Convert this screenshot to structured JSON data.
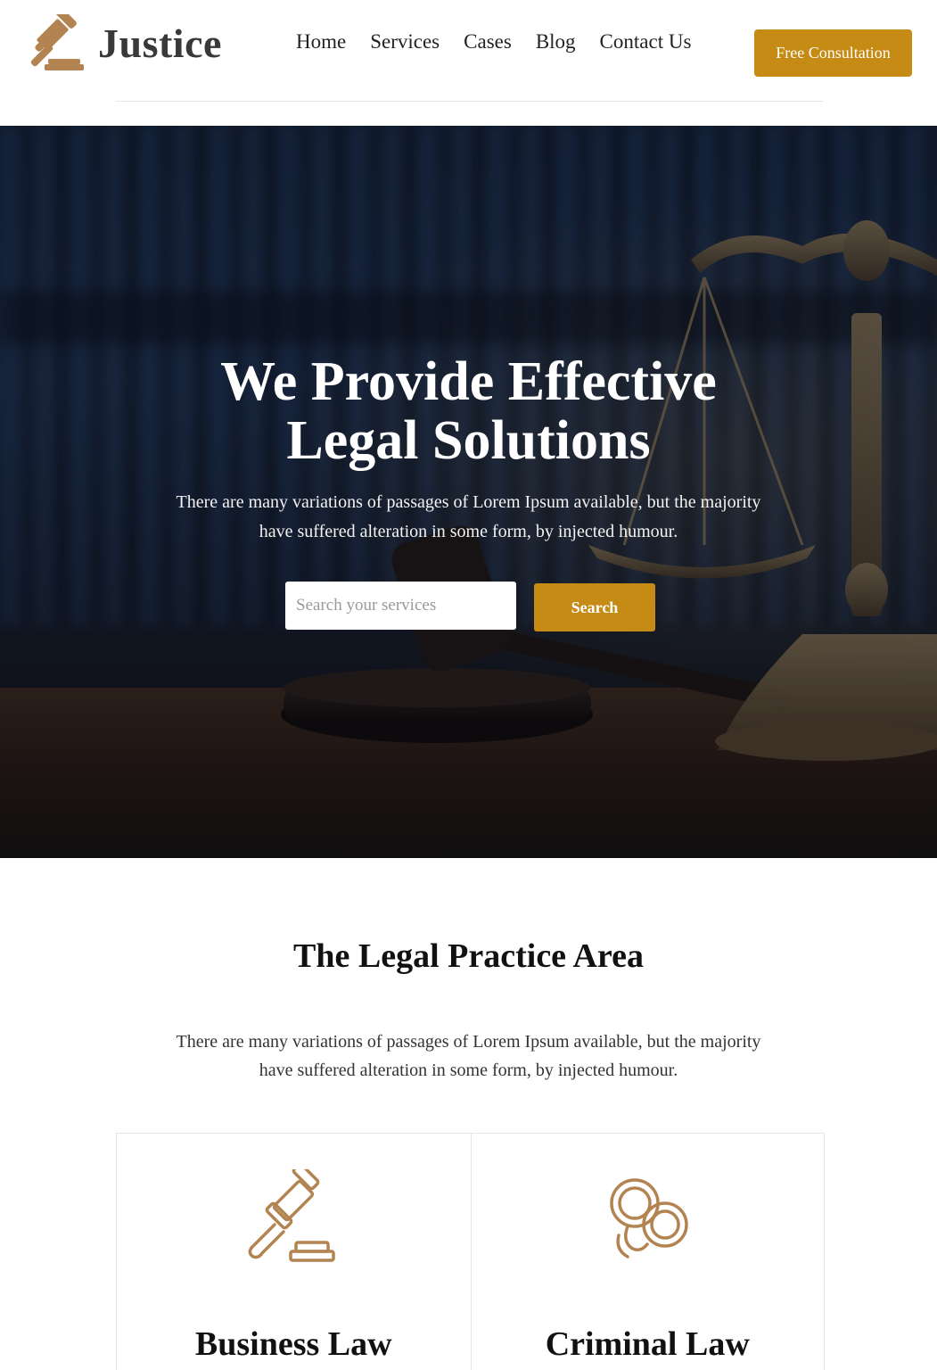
{
  "brand": {
    "name": "Justice",
    "accent": "#c58b15",
    "logo_color": "#b38451",
    "logo_icon": "gavel-icon"
  },
  "nav": {
    "items": [
      {
        "label": "Home"
      },
      {
        "label": "Services"
      },
      {
        "label": "Cases"
      },
      {
        "label": "Blog"
      },
      {
        "label": "Contact Us"
      }
    ],
    "cta_label": "Free Consultation"
  },
  "hero": {
    "title_line1": "We Provide Effective",
    "title_line2": "Legal Solutions",
    "subtitle_line1": "There are many variations of passages of Lorem Ipsum available, but the majority",
    "subtitle_line2": "have suffered alteration in some form, by injected humour.",
    "search_placeholder": "Search your services",
    "search_value": "",
    "search_button": "Search"
  },
  "practice": {
    "title": "The Legal Practice Area",
    "subtitle_line1": "There are many variations of passages of Lorem Ipsum available, but the majority",
    "subtitle_line2": "have suffered alteration in some form, by injected humour.",
    "cards": [
      {
        "title": "Business Law",
        "icon": "gavel-icon"
      },
      {
        "title": "Criminal Law",
        "icon": "handcuffs-icon"
      }
    ]
  }
}
